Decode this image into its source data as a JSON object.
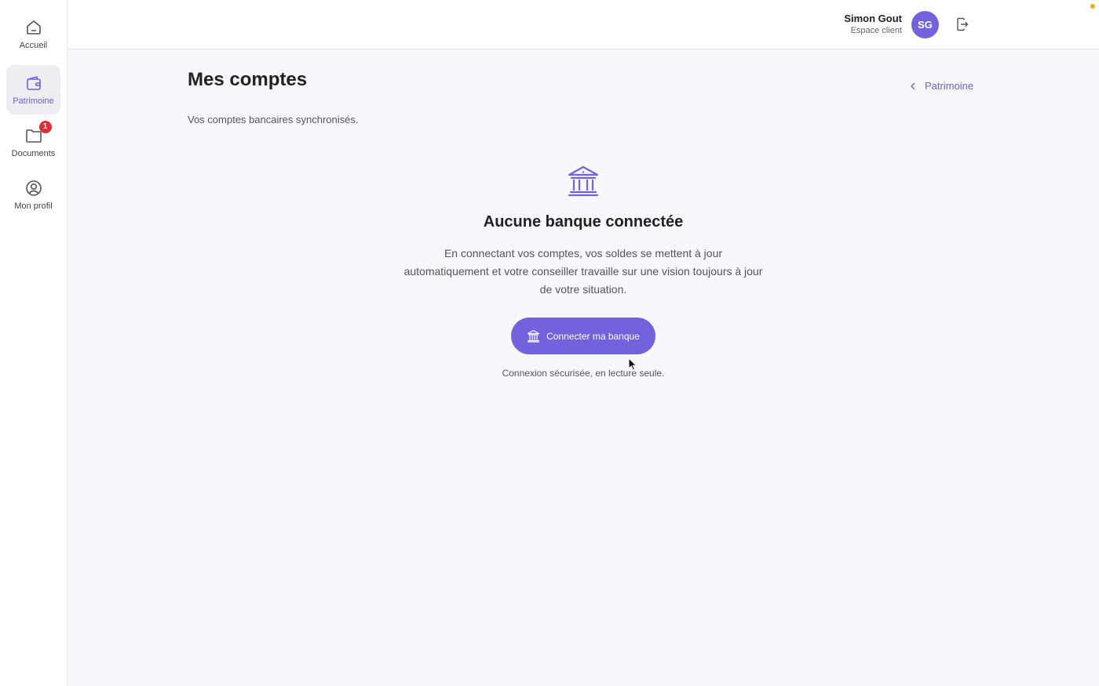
{
  "sidebar": {
    "items": [
      {
        "label": "Accueil",
        "icon": "home-icon"
      },
      {
        "label": "Patrimoine",
        "icon": "wallet-icon",
        "active": true
      },
      {
        "label": "Documents",
        "icon": "folder-icon",
        "badge": "1"
      },
      {
        "label": "Mon profil",
        "icon": "user-circle-icon"
      }
    ]
  },
  "header": {
    "user_name": "Simon Gout",
    "user_role": "Espace client",
    "avatar_initials": "SG",
    "logout_icon": "logout-icon"
  },
  "main": {
    "title": "Mes comptes",
    "subtitle": "Vos comptes bancaires synchronisés.",
    "back_link": "Patrimoine",
    "empty_state": {
      "icon": "bank-icon",
      "title": "Aucune banque connectée",
      "description": "En connectant vos comptes, vos soldes se mettent à jour automatiquement et votre conseiller travaille sur une vision toujours à jour de votre situation.",
      "button_label": "Connecter ma banque",
      "note": "Connexion sécurisée, en lecture seule."
    }
  },
  "colors": {
    "accent": "#7262de",
    "accent_text": "#6d5fd6",
    "badge": "#dc3034",
    "status_dot": "#f2a81d",
    "background": "#f7f7fb"
  }
}
